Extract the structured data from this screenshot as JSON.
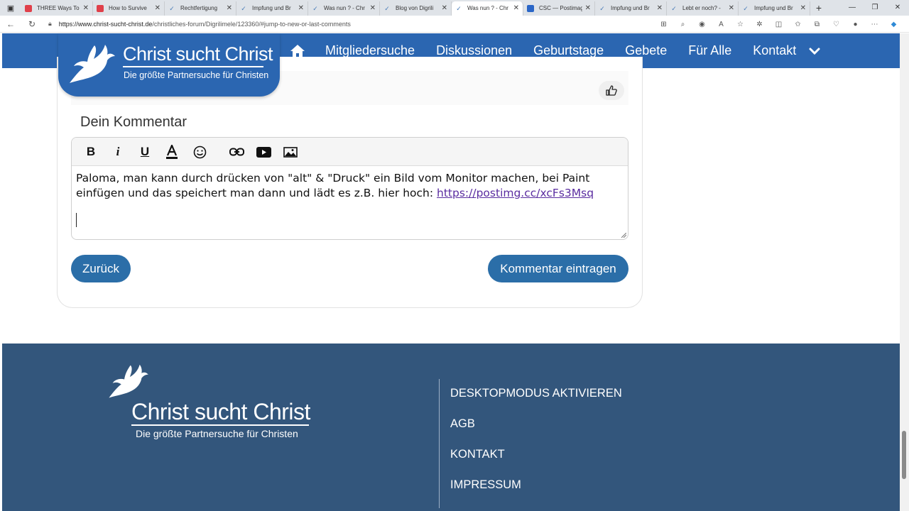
{
  "browser": {
    "tabs": [
      {
        "title": "THREE Ways To",
        "favicon": "youtube-icon",
        "active": false
      },
      {
        "title": "How to Survive",
        "favicon": "youtube-icon",
        "active": false
      },
      {
        "title": "Rechtfertigung",
        "favicon": "dove-icon",
        "active": false
      },
      {
        "title": "Impfung und Br",
        "favicon": "dove-icon",
        "active": false
      },
      {
        "title": "Was nun ? - Chr",
        "favicon": "dove-icon",
        "active": false
      },
      {
        "title": "Blog von Digrili",
        "favicon": "dove-icon",
        "active": false
      },
      {
        "title": "Was nun ? - Chr",
        "favicon": "dove-icon",
        "active": true
      },
      {
        "title": "CSC — Postimag",
        "favicon": "postimage-icon",
        "active": false
      },
      {
        "title": "Impfung und Br",
        "favicon": "dove-icon",
        "active": false
      },
      {
        "title": "Lebt er noch? -",
        "favicon": "dove-icon",
        "active": false
      },
      {
        "title": "Impfung und Br",
        "favicon": "dove-icon",
        "active": false
      }
    ],
    "url_host": "https://www.christ-sucht-christ.de",
    "url_path": "/christliches-forum/Digrilimele/123360/#jump-to-new-or-last-comments"
  },
  "site": {
    "logo_title": "Christ sucht Christ",
    "logo_subtitle": "Die größte Partnersuche für Christen",
    "nav": [
      "Mitgliedersuche",
      "Diskussionen",
      "Geburtstage",
      "Gebete",
      "Für Alle",
      "Kontakt"
    ]
  },
  "comment": {
    "heading": "Dein Kommentar",
    "text_line1": "Paloma, man kann durch drücken von \"alt\" & \"Druck\" ein Bild vom Monitor machen, bei Paint",
    "text_line2": "einfügen und das speichert man dann und lädt es z.B. hier hoch: ",
    "link": "https://postimg.cc/xcFs3Msq",
    "back_label": "Zurück",
    "submit_label": "Kommentar eintragen"
  },
  "footer": {
    "logo_title": "Christ sucht Christ",
    "logo_subtitle": "Die größte Partnersuche für Christen",
    "links": [
      "DESKTOPMODUS AKTIVIEREN",
      "AGB",
      "KONTAKT",
      "IMPRESSUM"
    ]
  },
  "colors": {
    "brand_blue": "#2b66b1",
    "button_blue": "#2b6ea8",
    "footer_blue": "#33567c"
  }
}
